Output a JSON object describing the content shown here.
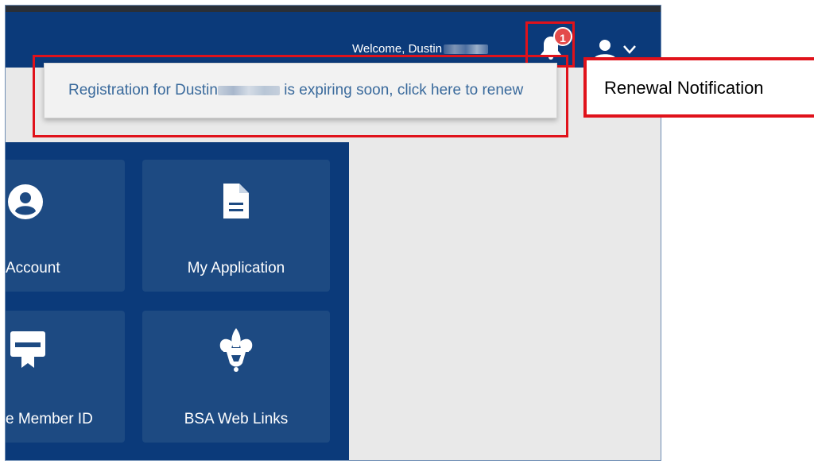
{
  "header": {
    "welcome_text": "Welcome, Dustin",
    "notification_count": "1"
  },
  "notification": {
    "text_before": "Registration for Dustin",
    "text_after": " is expiring soon, click here to renew"
  },
  "tiles": [
    {
      "label": "Account",
      "icon": "account-circle-icon"
    },
    {
      "label": "My Application",
      "icon": "document-icon"
    },
    {
      "label": "e Member ID",
      "icon": "member-id-card-icon"
    },
    {
      "label": "BSA Web Links",
      "icon": "fleur-de-lis-icon"
    }
  ],
  "callout": {
    "label": "Renewal Notification"
  },
  "colors": {
    "header_blue": "#0b3a7a",
    "tile_blue": "#1d4a82",
    "highlight_red": "#e0121b",
    "badge_red": "#e34b4b",
    "notification_text": "#3a6a9c"
  }
}
